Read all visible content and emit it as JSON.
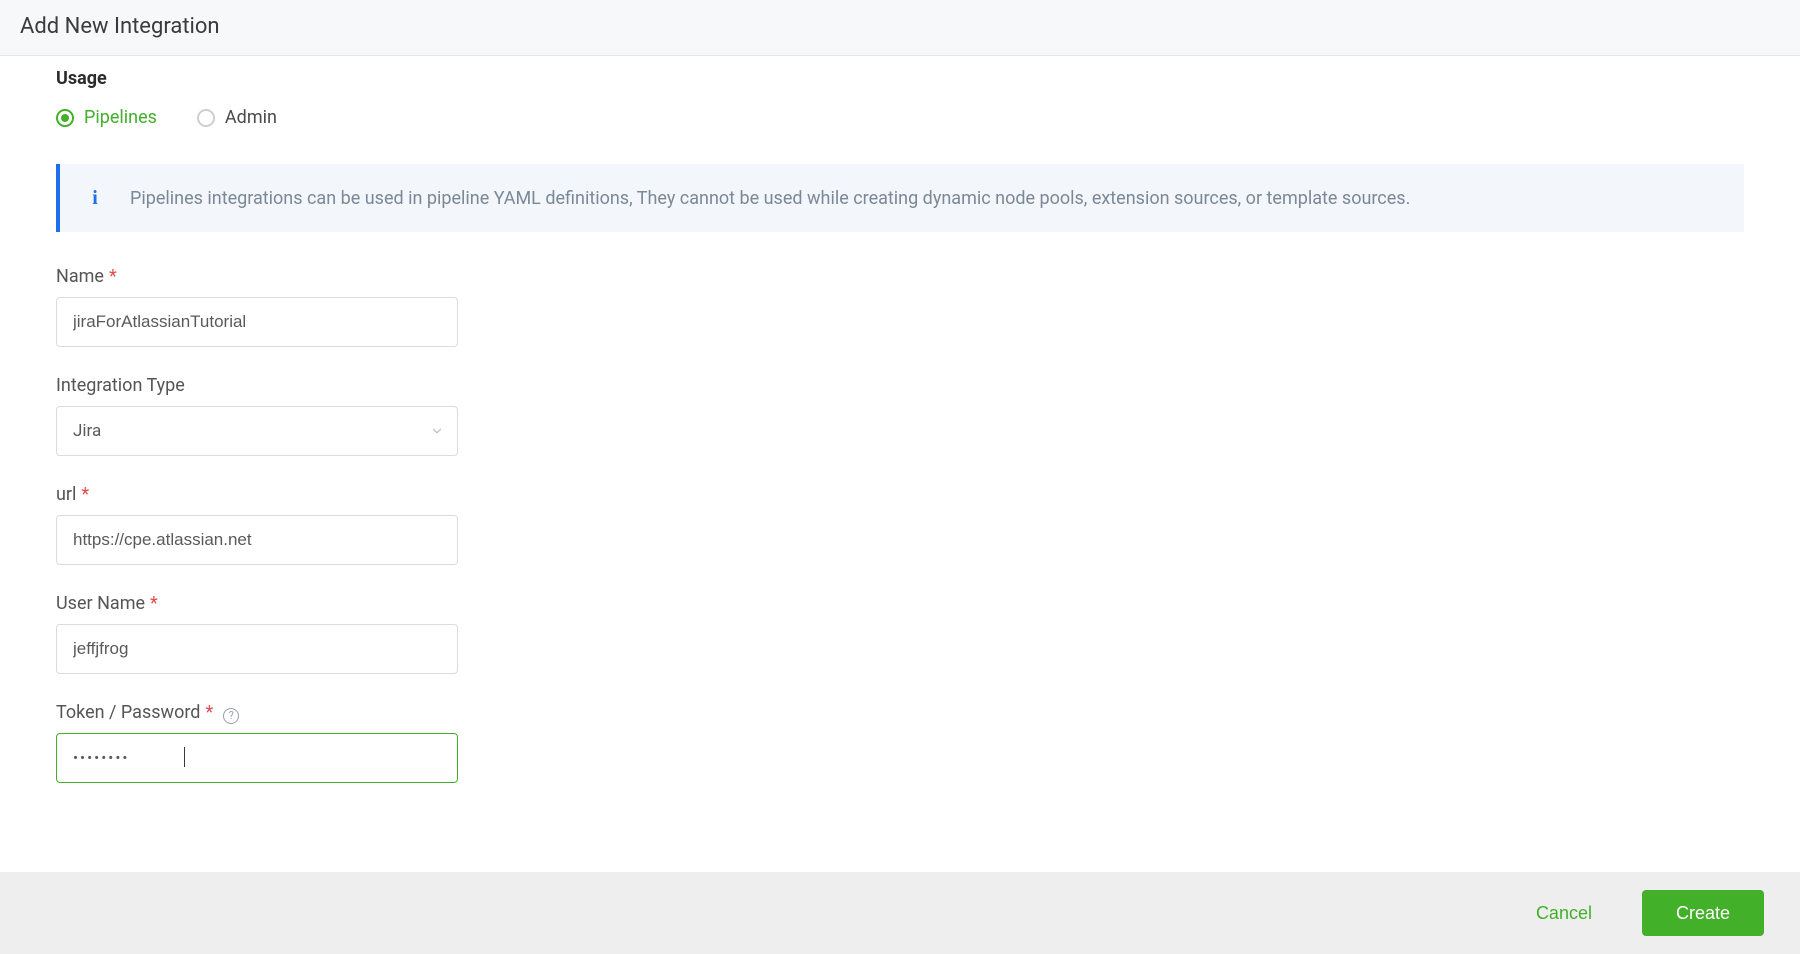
{
  "colors": {
    "accent_green": "#43b02a",
    "info_blue": "#1f6feb",
    "required_red": "#e24c4c"
  },
  "header": {
    "title": "Add New Integration"
  },
  "usage": {
    "section_label": "Usage",
    "options": {
      "pipelines": {
        "label": "Pipelines",
        "selected": true
      },
      "admin": {
        "label": "Admin",
        "selected": false
      }
    }
  },
  "info_banner": {
    "icon": "i",
    "text": "Pipelines integrations can be used in pipeline YAML definitions, They cannot be used while creating dynamic node pools, extension sources, or template sources."
  },
  "form": {
    "name": {
      "label": "Name",
      "required": true,
      "value": "jiraForAtlassianTutorial"
    },
    "integration_type": {
      "label": "Integration Type",
      "required": false,
      "selected": "Jira"
    },
    "url": {
      "label": "url",
      "required": true,
      "value": "https://cpe.atlassian.net"
    },
    "user_name": {
      "label": "User Name",
      "required": true,
      "value": "jeffjfrog"
    },
    "token_password": {
      "label": "Token / Password",
      "required": true,
      "help_tooltip": "?",
      "masked_value": "••••••••"
    }
  },
  "footer": {
    "cancel_label": "Cancel",
    "create_label": "Create"
  }
}
